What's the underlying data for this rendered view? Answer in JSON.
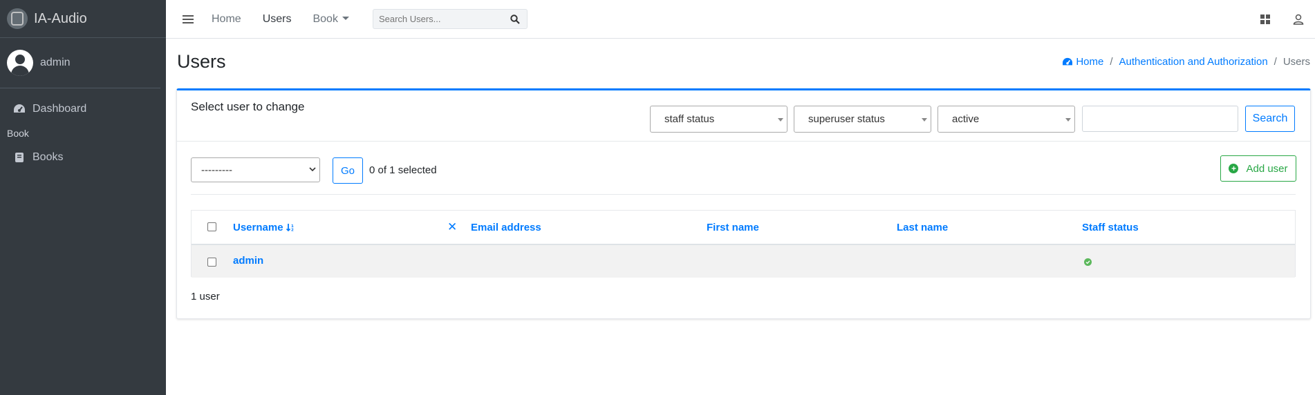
{
  "brand": {
    "name": "IA-Audio"
  },
  "sidebar": {
    "user": "admin",
    "items": [
      {
        "label": "Dashboard",
        "icon": "dashboard-icon"
      },
      {
        "header": "Book"
      },
      {
        "label": "Books",
        "icon": "book-icon"
      }
    ]
  },
  "topbar": {
    "links": [
      "Home",
      "Users",
      "Book"
    ],
    "search_placeholder": "Search Users..."
  },
  "page": {
    "title": "Users",
    "breadcrumb": [
      "Home",
      "Authentication and Authorization",
      "Users"
    ]
  },
  "card": {
    "title": "Select user to change",
    "filters": [
      "staff status",
      "superuser status",
      "active"
    ],
    "search_value": "",
    "search_label": "Search",
    "action_default": "---------",
    "go_label": "Go",
    "selected_text": "0 of 1 selected",
    "add_label": "Add user"
  },
  "table": {
    "columns": [
      "Username",
      "Email address",
      "First name",
      "Last name",
      "Staff status"
    ],
    "rows": [
      {
        "username": "admin",
        "email": "",
        "first_name": "",
        "last_name": "",
        "staff_status": true
      }
    ],
    "result_count": "1 user"
  },
  "colors": {
    "primary": "#007bff",
    "success": "#28a745",
    "sidebar": "#343a40"
  }
}
